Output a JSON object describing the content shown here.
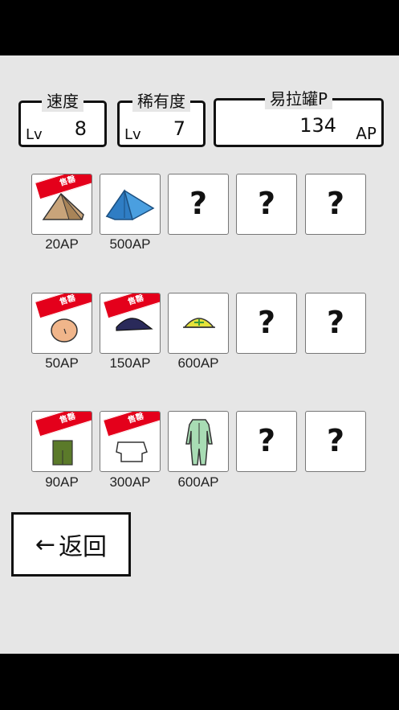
{
  "stats": {
    "speed": {
      "title": "速度",
      "lv_label": "Lv",
      "value": "8"
    },
    "rarity": {
      "title": "稀有度",
      "lv_label": "Lv",
      "value": "7"
    },
    "points": {
      "title": "易拉罐P",
      "value": "134",
      "unit": "AP"
    }
  },
  "sold_label": "售罄",
  "unknown_symbol": "?",
  "rows": [
    {
      "items": [
        {
          "icon": "tan-tent-icon",
          "sold": true,
          "price": "20AP"
        },
        {
          "icon": "blue-tent-icon",
          "sold": false,
          "price": "500AP"
        },
        {
          "icon": "unknown",
          "price": ""
        },
        {
          "icon": "unknown",
          "price": ""
        },
        {
          "icon": "unknown",
          "price": ""
        }
      ]
    },
    {
      "items": [
        {
          "icon": "face-icon",
          "sold": true,
          "price": "50AP"
        },
        {
          "icon": "cap-icon",
          "sold": true,
          "price": "150AP"
        },
        {
          "icon": "yellow-helmet-icon",
          "sold": false,
          "price": "600AP"
        },
        {
          "icon": "unknown",
          "price": ""
        },
        {
          "icon": "unknown",
          "price": ""
        }
      ]
    },
    {
      "items": [
        {
          "icon": "green-shirt-icon",
          "sold": true,
          "price": "90AP"
        },
        {
          "icon": "white-shirt-icon",
          "sold": true,
          "price": "300AP"
        },
        {
          "icon": "green-overalls-icon",
          "sold": false,
          "price": "600AP"
        },
        {
          "icon": "unknown",
          "price": ""
        },
        {
          "icon": "unknown",
          "price": ""
        }
      ]
    }
  ],
  "back_button": {
    "arrow": "←",
    "label": "返回"
  }
}
